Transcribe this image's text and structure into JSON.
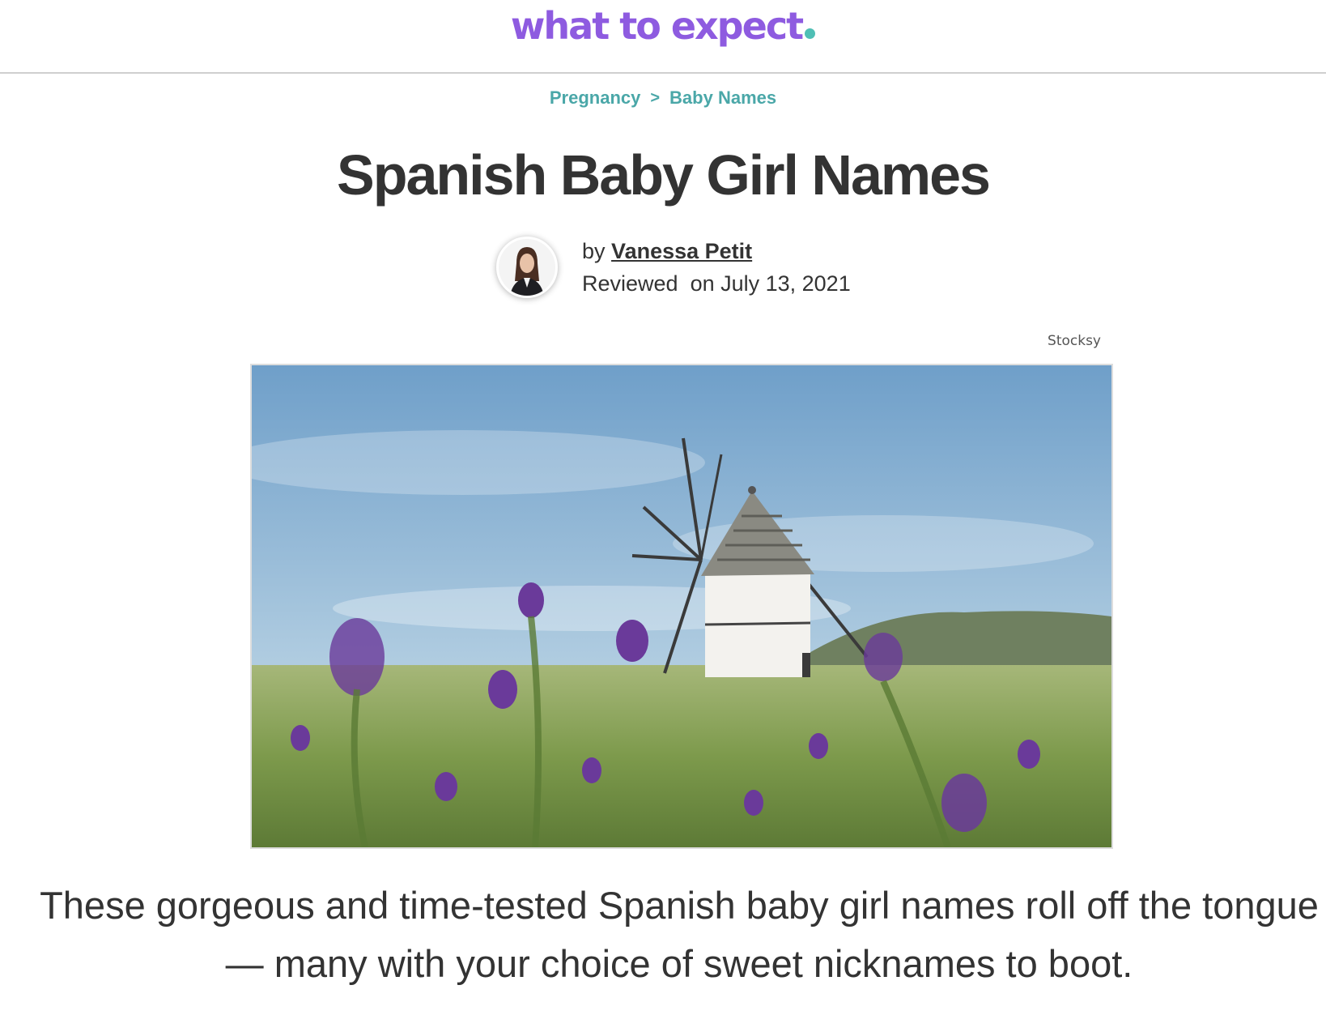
{
  "header": {
    "logo_text": "what to expect"
  },
  "breadcrumb": {
    "items": [
      "Pregnancy",
      "Baby Names"
    ],
    "separator": ">"
  },
  "article": {
    "title": "Spanish Baby Girl Names",
    "byline_prefix": "by",
    "author": "Vanessa Petit",
    "reviewed_text": "Reviewed  on July 13, 2021",
    "image_credit": "Stocksy",
    "intro": "These gorgeous and time-tested Spanish baby girl names roll off the tongue — many with your choice of sweet nicknames to boot."
  },
  "colors": {
    "brand_purple": "#8e5be0",
    "brand_teal": "#4fbfb5",
    "breadcrumb_teal": "#4aa7a8",
    "text_dark": "#333333"
  }
}
